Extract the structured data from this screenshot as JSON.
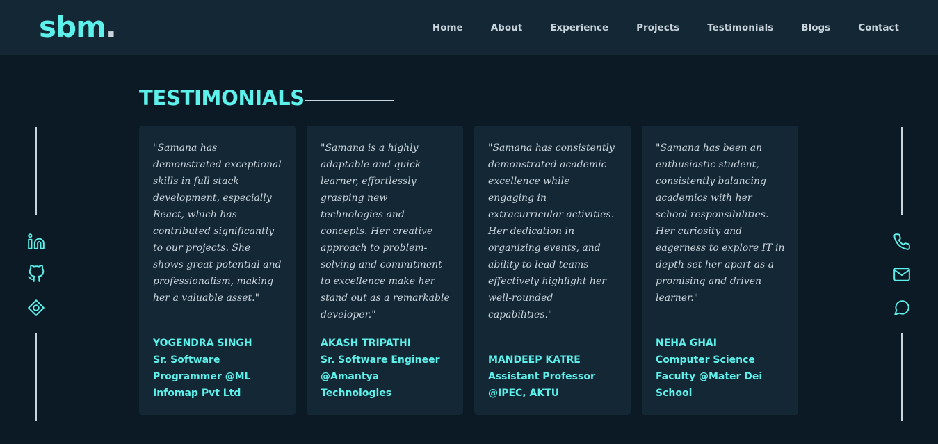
{
  "header": {
    "logo_text": "sbm",
    "logo_dot": ".",
    "nav": [
      "Home",
      "About",
      "Experience",
      "Projects",
      "Testimonials",
      "Blogs",
      "Contact"
    ]
  },
  "section": {
    "title": "TESTIMONIALS"
  },
  "testimonials": [
    {
      "quote": "\"Samana has demonstrated exceptional skills in full stack development, especially React, which has contributed significantly to our projects. She shows great potential and professionalism, making her a valuable asset.\"",
      "name": "YOGENDRA SINGH",
      "role": "Sr. Software Programmer @ML Infomap Pvt Ltd"
    },
    {
      "quote": "\"Samana is a highly adaptable and quick learner, effortlessly grasping new technologies and concepts. Her creative approach to problem-solving and commitment to excellence make her stand out as a remarkable developer.\"",
      "name": "AKASH TRIPATHI",
      "role": "Sr. Software Engineer @Amantya Technologies"
    },
    {
      "quote": "\"Samana has consistently demonstrated academic excellence while engaging in extracurricular activities. Her dedication in organizing events, and ability to lead teams effectively highlight her well-rounded capabilities.\"",
      "name": "MANDEEP KATRE",
      "role": "Assistant Professor @IPEC, AKTU"
    },
    {
      "quote": "\"Samana has been an enthusiastic student, consistently balancing academics with her school responsibilities. Her curiosity and eagerness to explore IT in depth set her apart as a promising and driven learner.\"",
      "name": "NEHA GHAI",
      "role": "Computer Science Faculty @Mater Dei School"
    }
  ],
  "left_icons": [
    "linkedin-icon",
    "github-icon",
    "location-icon"
  ],
  "right_icons": [
    "phone-icon",
    "mail-icon",
    "chat-icon"
  ],
  "colors": {
    "background": "#0b1a24",
    "surface": "#132735",
    "accent": "#5ef0ea",
    "text": "#c9d4dc"
  }
}
